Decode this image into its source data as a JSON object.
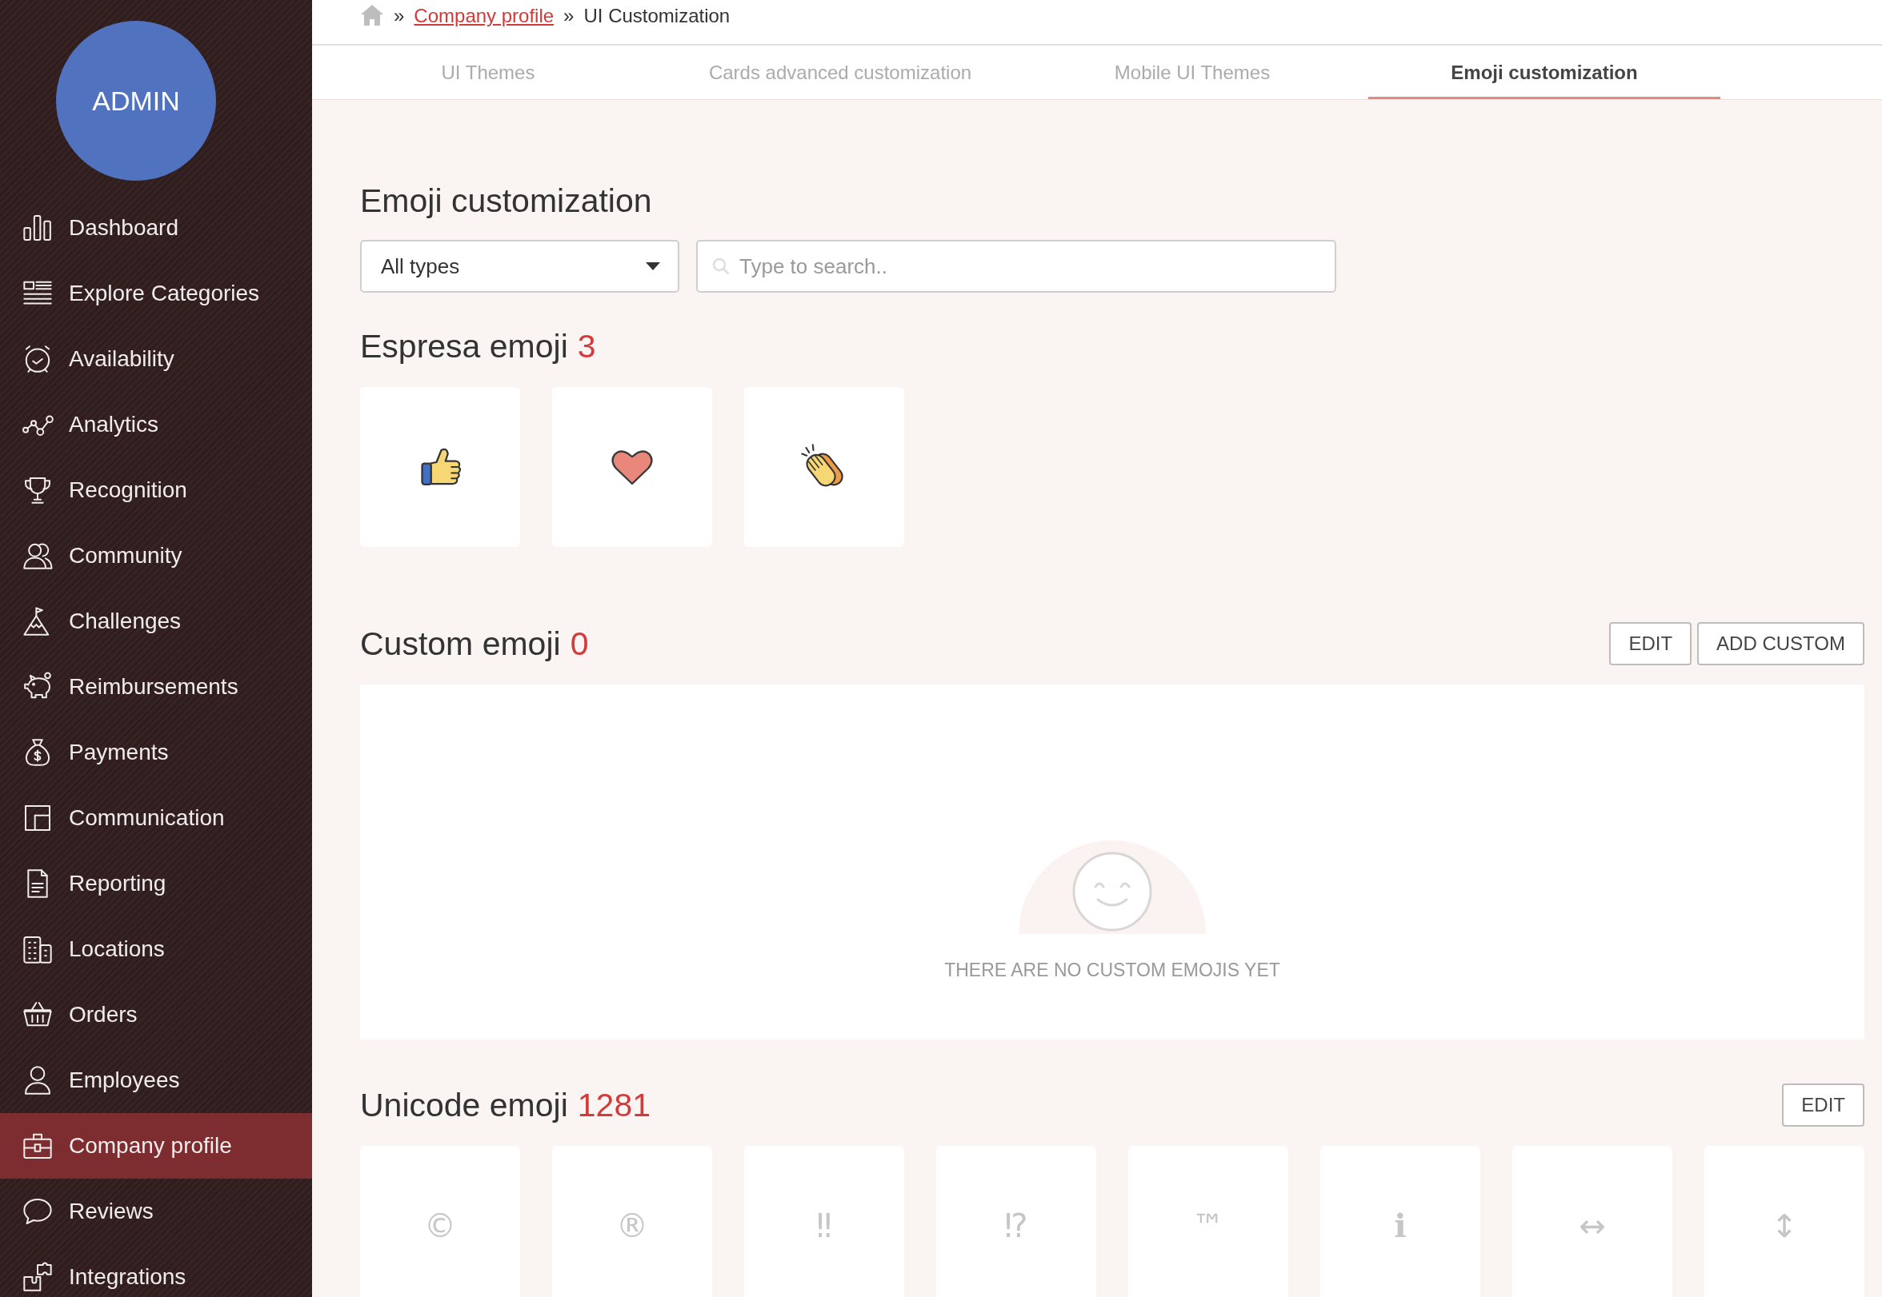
{
  "sidebar": {
    "avatar": {
      "label": "ADMIN"
    },
    "items": [
      {
        "label": "Dashboard",
        "selected": false
      },
      {
        "label": "Explore Categories",
        "selected": false
      },
      {
        "label": "Availability",
        "selected": false
      },
      {
        "label": "Analytics",
        "selected": false
      },
      {
        "label": "Recognition",
        "selected": false
      },
      {
        "label": "Community",
        "selected": false
      },
      {
        "label": "Challenges",
        "selected": false
      },
      {
        "label": "Reimbursements",
        "selected": false
      },
      {
        "label": "Payments",
        "selected": false
      },
      {
        "label": "Communication",
        "selected": false
      },
      {
        "label": "Reporting",
        "selected": false
      },
      {
        "label": "Locations",
        "selected": false
      },
      {
        "label": "Orders",
        "selected": false
      },
      {
        "label": "Employees",
        "selected": false
      },
      {
        "label": "Company profile",
        "selected": true
      },
      {
        "label": "Reviews",
        "selected": false
      },
      {
        "label": "Integrations",
        "selected": false
      }
    ]
  },
  "breadcrumb": [
    {
      "separator": "»",
      "label": "Company profile",
      "kind": "link"
    },
    {
      "separator": "»",
      "label": "UI Customization",
      "kind": "current"
    }
  ],
  "tabs": [
    {
      "label": "UI Themes",
      "selected": false
    },
    {
      "label": "Cards advanced customization",
      "selected": false
    },
    {
      "label": "Mobile UI Themes",
      "selected": false
    },
    {
      "label": "Emoji customization",
      "selected": true
    }
  ],
  "page": {
    "title": "Emoji customization",
    "filter": {
      "value": "All types"
    },
    "search": {
      "placeholder": "Type to search.."
    }
  },
  "espresa_emoji": {
    "title": "Espresa emoji",
    "count": "3",
    "items": [
      {
        "kind": "thumbsup"
      },
      {
        "kind": "heart"
      },
      {
        "kind": "clap"
      }
    ]
  },
  "custom_emoji": {
    "title": "Custom emoji",
    "count": "0",
    "buttons": [
      "EDIT",
      "ADD CUSTOM"
    ],
    "empty_message": "THERE ARE NO CUSTOM EMOJIS YET"
  },
  "unicode_emoji": {
    "title": "Unicode emoji",
    "count": "1281",
    "buttons": [
      "EDIT"
    ],
    "items": [
      {
        "symbol": "©"
      },
      {
        "symbol": "®"
      },
      {
        "symbol": "‼"
      },
      {
        "symbol": "⁉"
      },
      {
        "symbol": "™"
      },
      {
        "symbol": "ℹ"
      },
      {
        "symbol": "↔"
      },
      {
        "symbol": "↕"
      }
    ]
  }
}
